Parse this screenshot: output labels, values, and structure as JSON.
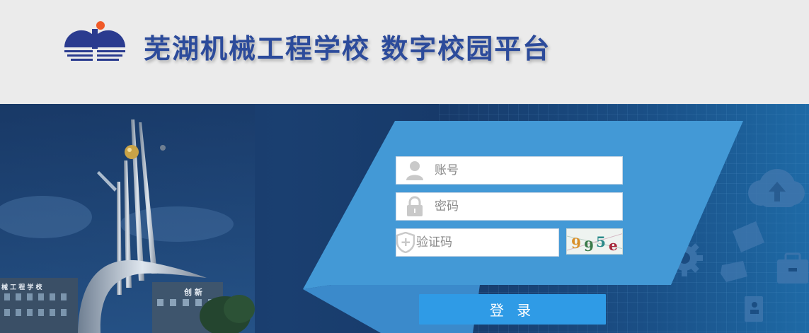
{
  "header": {
    "title": "芜湖机械工程学校  数字校园平台"
  },
  "campus_sign": {
    "left_text": "械 工 程 学 校",
    "right_text": "创  新"
  },
  "login": {
    "username_placeholder": "账号",
    "password_placeholder": "密码",
    "captcha_placeholder": "验证码",
    "captcha_text": [
      "9",
      "9",
      "5",
      "e"
    ],
    "submit_label": "登 录"
  },
  "icons": {
    "username": "user-icon",
    "password": "lock-icon",
    "captcha": "shield-plus-icon",
    "logo": "school-logo-icon",
    "decorative": [
      "cloud-upload-icon",
      "gear-icon",
      "wallet-icon",
      "tag-icon",
      "briefcase-icon",
      "contact-book-icon"
    ]
  },
  "colors": {
    "header_bg": "#ebebeb",
    "title": "#2c4b9b",
    "banner_dark": "#163764",
    "panel": "#4399d6",
    "button": "#2f9be6",
    "logo_dot": "#f05a28"
  }
}
